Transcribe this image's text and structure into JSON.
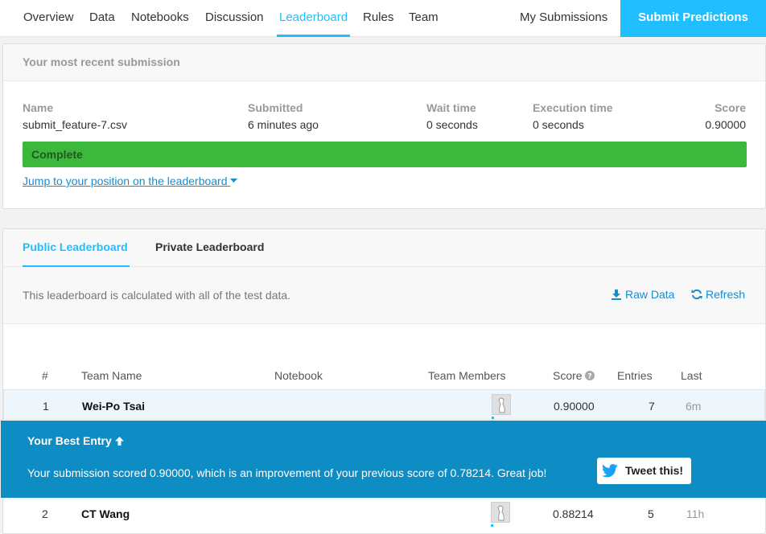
{
  "nav": {
    "tabs": [
      "Overview",
      "Data",
      "Notebooks",
      "Discussion",
      "Leaderboard",
      "Rules",
      "Team"
    ],
    "my_submissions": "My Submissions",
    "submit_predictions": "Submit Predictions"
  },
  "recent_submission": {
    "title": "Your most recent submission",
    "columns": {
      "name": {
        "label": "Name",
        "value": "submit_feature-7.csv"
      },
      "submitted": {
        "label": "Submitted",
        "value": "6 minutes ago"
      },
      "wait_time": {
        "label": "Wait time",
        "value": "0 seconds"
      },
      "execution_time": {
        "label": "Execution time",
        "value": "0 seconds"
      },
      "score": {
        "label": "Score",
        "value": "0.90000"
      }
    },
    "status": "Complete",
    "jump_link": "Jump to your position on the leaderboard"
  },
  "leaderboard": {
    "tabs": {
      "public": "Public Leaderboard",
      "private": "Private Leaderboard"
    },
    "description": "This leaderboard is calculated with all of the test data.",
    "raw_data": "Raw Data",
    "refresh": "Refresh",
    "headers": {
      "rank": "#",
      "team_name": "Team Name",
      "notebook": "Notebook",
      "team_members": "Team Members",
      "score": "Score",
      "entries": "Entries",
      "last": "Last"
    },
    "rows": [
      {
        "rank": "1",
        "team": "Wei-Po Tsai",
        "score": "0.90000",
        "entries": "7",
        "last": "6m"
      },
      {
        "rank": "2",
        "team": "CT Wang",
        "score": "0.88214",
        "entries": "5",
        "last": "11h"
      }
    ],
    "best_entry": {
      "title": "Your Best Entry",
      "message": "Your submission scored 0.90000, which is an improvement of your previous score of 0.78214. Great job!",
      "tweet_label": "Tweet this!"
    }
  },
  "colors": {
    "accent": "#20beff",
    "complete_bar": "#3cb83c",
    "best_entry_bg": "#0e8cc4",
    "link": "#1a8ccc"
  },
  "icons": [
    "download-icon",
    "refresh-icon",
    "help-circle-icon",
    "arrow-up-icon",
    "twitter-icon",
    "caret-down-icon"
  ]
}
